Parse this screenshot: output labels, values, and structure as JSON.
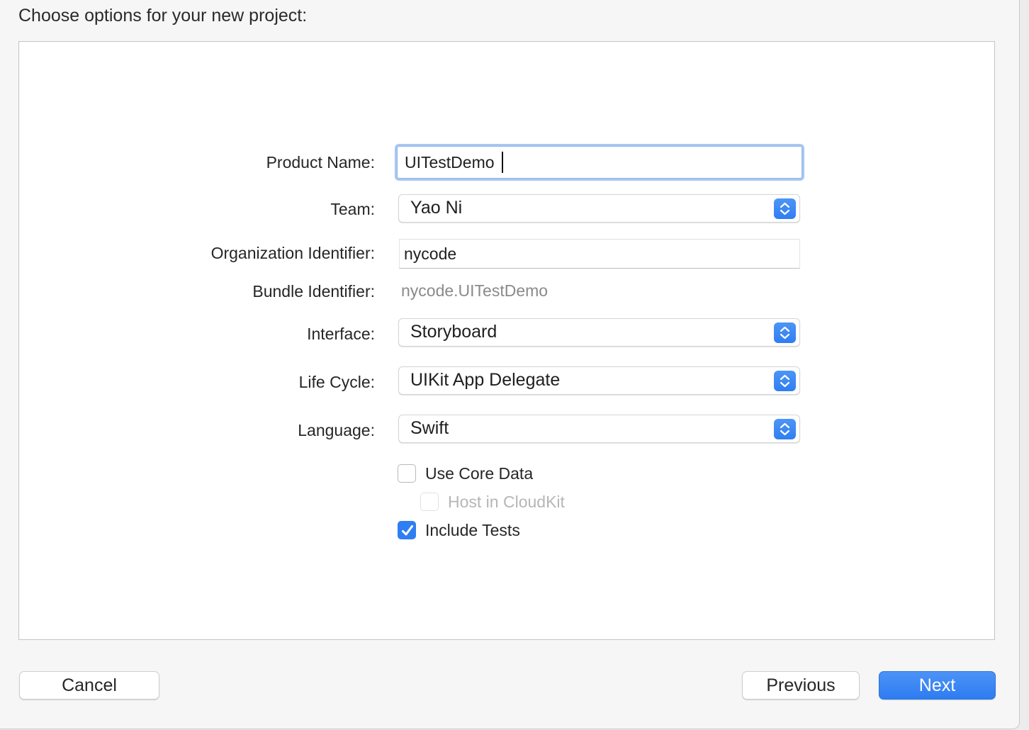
{
  "dialog": {
    "title": "Choose options for your new project:"
  },
  "form": {
    "product_name": {
      "label": "Product Name:",
      "value": "UITestDemo"
    },
    "team": {
      "label": "Team:",
      "value": "Yao Ni"
    },
    "organization_identifier": {
      "label": "Organization Identifier:",
      "value": "nycode"
    },
    "bundle_identifier": {
      "label": "Bundle Identifier:",
      "value": "nycode.UITestDemo"
    },
    "interface": {
      "label": "Interface:",
      "value": "Storyboard"
    },
    "life_cycle": {
      "label": "Life Cycle:",
      "value": "UIKit App Delegate"
    },
    "language": {
      "label": "Language:",
      "value": "Swift"
    }
  },
  "options": {
    "use_core_data": {
      "label": "Use Core Data",
      "checked": false,
      "enabled": true
    },
    "host_in_cloudkit": {
      "label": "Host in CloudKit",
      "checked": false,
      "enabled": false
    },
    "include_tests": {
      "label": "Include Tests",
      "checked": true,
      "enabled": true
    }
  },
  "buttons": {
    "cancel": "Cancel",
    "previous": "Previous",
    "next": "Next"
  },
  "colors": {
    "accent": "#2f7ef2",
    "focus_ring": "#a9c7f2"
  }
}
